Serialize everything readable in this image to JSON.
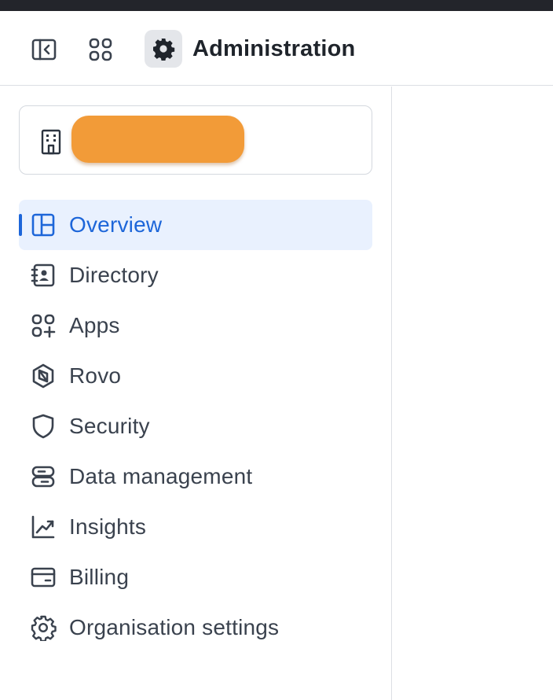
{
  "header": {
    "title": "Administration",
    "icons": {
      "sidebar_toggle": "sidebar-collapse-icon",
      "app_switcher": "app-grid-icon",
      "admin": "gear-icon"
    }
  },
  "org_selector": {
    "icon": "building-icon",
    "name_redacted": true,
    "redaction_color": "#f29b38"
  },
  "nav": {
    "active_index": 0,
    "accent_color": "#1d66d9",
    "active_bg": "#e9f1fe",
    "items": [
      {
        "label": "Overview",
        "icon": "overview-icon"
      },
      {
        "label": "Directory",
        "icon": "directory-icon"
      },
      {
        "label": "Apps",
        "icon": "apps-icon"
      },
      {
        "label": "Rovo",
        "icon": "rovo-icon"
      },
      {
        "label": "Security",
        "icon": "shield-icon"
      },
      {
        "label": "Data management",
        "icon": "database-icon"
      },
      {
        "label": "Insights",
        "icon": "chart-line-icon"
      },
      {
        "label": "Billing",
        "icon": "credit-card-icon"
      },
      {
        "label": "Organisation settings",
        "icon": "gear-icon"
      }
    ]
  }
}
